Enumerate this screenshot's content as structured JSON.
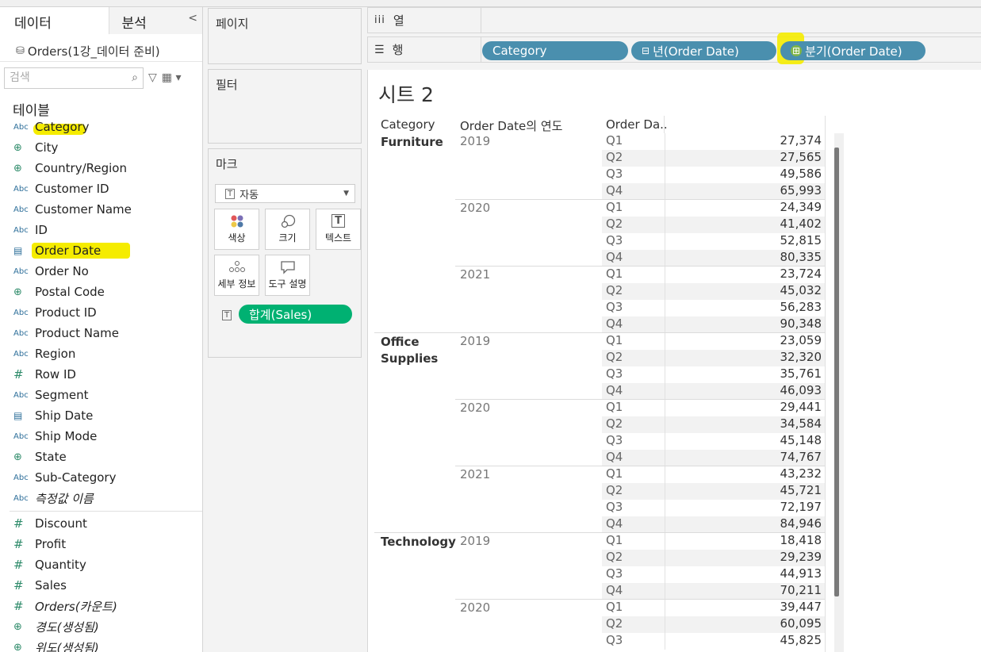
{
  "left_pane": {
    "tab_data": "데이터",
    "tab_analysis": "분석",
    "collapse_glyph": "<",
    "datasource": "Orders(1강_데이터 준비)",
    "search_placeholder": "검색",
    "tables_header": "테이블",
    "dimensions": [
      {
        "name": "Category",
        "type": "Abc"
      },
      {
        "name": "City",
        "type": "geo"
      },
      {
        "name": "Country/Region",
        "type": "geo"
      },
      {
        "name": "Customer ID",
        "type": "Abc"
      },
      {
        "name": "Customer Name",
        "type": "Abc"
      },
      {
        "name": "ID",
        "type": "Abc"
      },
      {
        "name": "Order Date",
        "type": "date"
      },
      {
        "name": "Order No",
        "type": "Abc"
      },
      {
        "name": "Postal Code",
        "type": "geo"
      },
      {
        "name": "Product ID",
        "type": "Abc"
      },
      {
        "name": "Product Name",
        "type": "Abc"
      },
      {
        "name": "Region",
        "type": "Abc"
      },
      {
        "name": "Row ID",
        "type": "num"
      },
      {
        "name": "Segment",
        "type": "Abc"
      },
      {
        "name": "Ship Date",
        "type": "date"
      },
      {
        "name": "Ship Mode",
        "type": "Abc"
      },
      {
        "name": "State",
        "type": "geo"
      },
      {
        "name": "Sub-Category",
        "type": "Abc"
      },
      {
        "name": "측정값 이름",
        "type": "Abc"
      }
    ],
    "measures": [
      {
        "name": "Discount",
        "type": "num"
      },
      {
        "name": "Profit",
        "type": "num"
      },
      {
        "name": "Quantity",
        "type": "num"
      },
      {
        "name": "Sales",
        "type": "num"
      },
      {
        "name": "Orders(카운트)",
        "type": "num"
      },
      {
        "name": "경도(생성됨)",
        "type": "geo"
      },
      {
        "name": "위도(생성됨)",
        "type": "geo"
      }
    ]
  },
  "shelves": {
    "pages_title": "페이지",
    "filters_title": "필터",
    "marks_title": "마크",
    "mark_type": "자동",
    "mark_buttons": [
      "색상",
      "크기",
      "텍스트",
      "세부 정보",
      "도구 설명"
    ],
    "sales_pill": "합계(Sales)",
    "columns_label": "열",
    "rows_label": "행",
    "row_pills": [
      "Category",
      "년(Order Date)",
      "분기(Order Date)"
    ],
    "row_pill_prefix": [
      "",
      "⊟",
      "⊞"
    ]
  },
  "sheet": {
    "title": "시트 2",
    "headers": [
      "Category",
      "Order Date의 연도",
      "Order Da.."
    ],
    "categories": [
      {
        "name": "Furniture",
        "years": [
          {
            "year": "2019",
            "values": [
              "27,374",
              "27,565",
              "49,586",
              "65,993"
            ]
          },
          {
            "year": "2020",
            "values": [
              "24,349",
              "41,402",
              "52,815",
              "80,335"
            ]
          },
          {
            "year": "2021",
            "values": [
              "23,724",
              "45,032",
              "56,283",
              "90,348"
            ]
          }
        ]
      },
      {
        "name": "Office\nSupplies",
        "years": [
          {
            "year": "2019",
            "values": [
              "23,059",
              "32,320",
              "35,761",
              "46,093"
            ]
          },
          {
            "year": "2020",
            "values": [
              "29,441",
              "34,584",
              "45,148",
              "74,767"
            ]
          },
          {
            "year": "2021",
            "values": [
              "43,232",
              "45,721",
              "72,197",
              "84,946"
            ]
          }
        ]
      },
      {
        "name": "Technology",
        "years": [
          {
            "year": "2019",
            "values": [
              "18,418",
              "29,239",
              "44,913",
              "70,211"
            ]
          },
          {
            "year": "2020",
            "values": [
              "39,447",
              "60,095",
              "45,825"
            ]
          }
        ]
      }
    ],
    "quarters": [
      "Q1",
      "Q2",
      "Q3",
      "Q4"
    ]
  }
}
